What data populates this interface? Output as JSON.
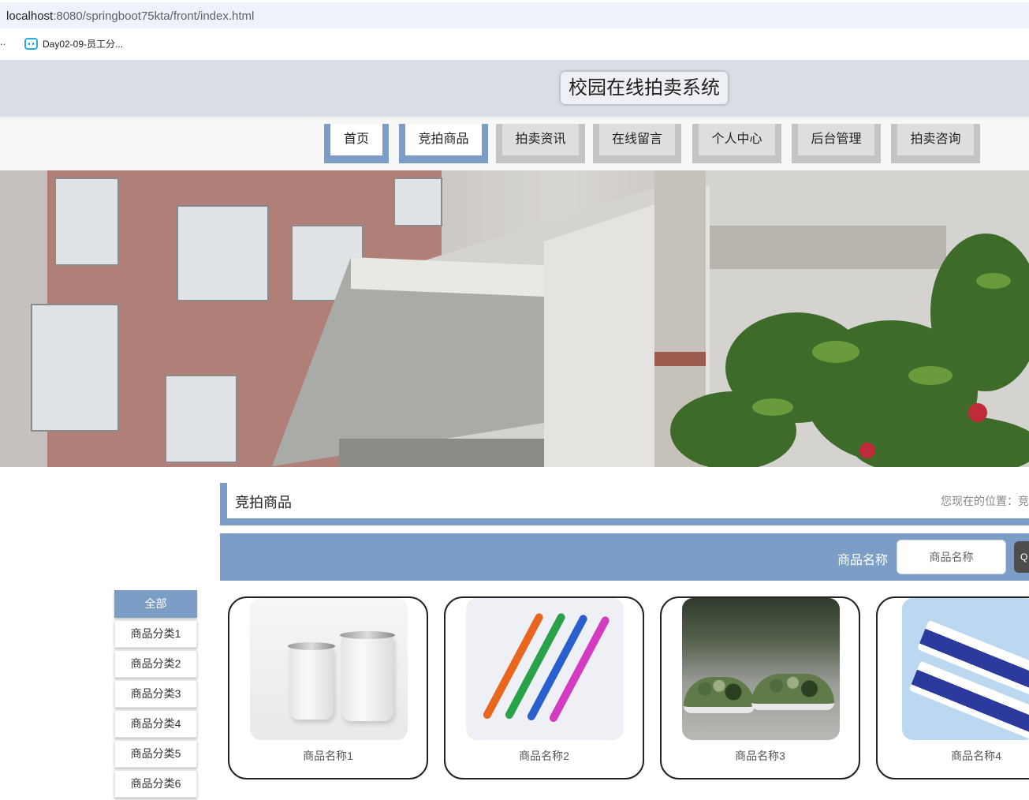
{
  "browser": {
    "url_host": "localhost",
    "url_rest": ":8080/springboot75kta/front/index.html",
    "bookmark_overflow": "..",
    "bookmark_label": "Day02-09-员工分..."
  },
  "site": {
    "title": "校园在线拍卖系统"
  },
  "nav": {
    "items": [
      {
        "label": "首页",
        "state": "active"
      },
      {
        "label": "竞拍商品",
        "state": "active"
      },
      {
        "label": "拍卖资讯",
        "state": "idle"
      },
      {
        "label": "在线留言",
        "state": "idle"
      },
      {
        "label": "个人中心",
        "state": "idle"
      },
      {
        "label": "后台管理",
        "state": "idle"
      },
      {
        "label": "拍卖咨询",
        "state": "idle"
      }
    ]
  },
  "banner": {
    "dots": 3,
    "active_dot": 2
  },
  "section": {
    "title": "竞拍商品",
    "breadcrumb": "您现在的位置：竞"
  },
  "search": {
    "label": "商品名称",
    "placeholder": "商品名称",
    "button_glyph": "Q"
  },
  "categories": [
    {
      "label": "全部",
      "active": true
    },
    {
      "label": "商品分类1",
      "active": false
    },
    {
      "label": "商品分类2",
      "active": false
    },
    {
      "label": "商品分类3",
      "active": false
    },
    {
      "label": "商品分类4",
      "active": false
    },
    {
      "label": "商品分类5",
      "active": false
    },
    {
      "label": "商品分类6",
      "active": false
    }
  ],
  "products": [
    {
      "name": "商品名称1",
      "image": "cups"
    },
    {
      "name": "商品名称2",
      "image": "toothbrushes"
    },
    {
      "name": "商品名称3",
      "image": "camo-shoes"
    },
    {
      "name": "商品名称4",
      "image": "toothpaste"
    }
  ],
  "colors": {
    "accent": "#7c9dc6",
    "active_dot": "#3f6aa2",
    "header_bg": "#d9dee6"
  }
}
